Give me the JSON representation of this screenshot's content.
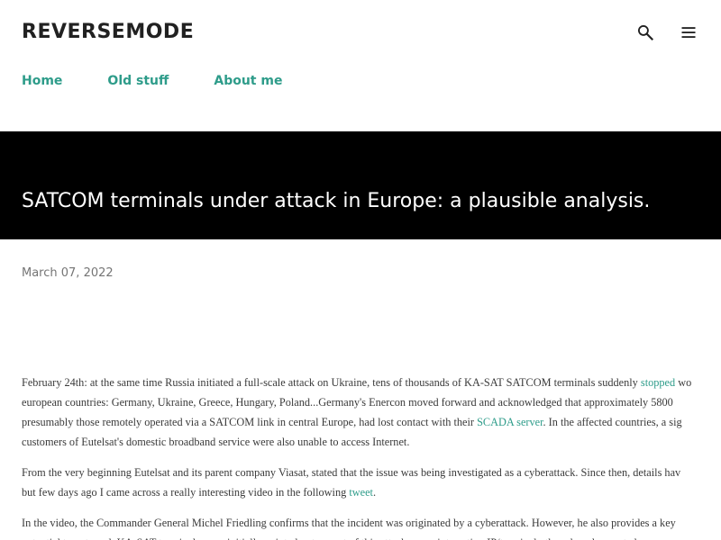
{
  "site": {
    "title": "REVERSEMODE"
  },
  "header": {
    "search_icon": "search-icon",
    "menu_icon": "menu-icon"
  },
  "nav": {
    "items": [
      {
        "label": "Home"
      },
      {
        "label": "Old stuff"
      },
      {
        "label": "About me"
      }
    ]
  },
  "post": {
    "title": "SATCOM terminals under attack in Europe: a plausible analysis.",
    "date": "March 07, 2022",
    "paragraphs": [
      {
        "line1_pre": "February 24th: at the same time Russia initiated a full-scale attack on Ukraine, tens of thousands of KA-SAT SATCOM terminals suddenly ",
        "line1_link": "stopped",
        "line1_post": " wo",
        "line2": "european countries: Germany, Ukraine, Greece, Hungary, Poland...Germany's Enercon moved forward and acknowledged that approximately 5800",
        "line3_pre": "presumably those remotely operated via a SATCOM link in central Europe, had lost contact with their ",
        "line3_link": "SCADA server",
        "line3_post": ".  In the affected countries, a sig",
        "line4": "customers of Eutelsat's domestic broadband service were also unable to access Internet."
      },
      {
        "line1": "From the very beginning Eutelsat and its parent company Viasat, stated that the issue was being investigated as a cyberattack. Since then, details hav",
        "line2_pre": "but few days ago I came across a really interesting video in the following ",
        "line2_link": "tweet",
        "line2_post": "."
      },
      {
        "line1": "In the video, the Commander General Michel Friedling confirms that the incident was originated by a cyberattack. However, he also provides a key",
        "line2": "potential targets and. KA-SAT terminals were initially pointed out as part of this attack, as an interesting IP/terminal...though and expected"
      }
    ]
  },
  "colors": {
    "accent": "#2e9c8a",
    "hero_bg": "#000000",
    "title_text": "#212121",
    "body_text": "#3a3a3a",
    "date_text": "#757575"
  }
}
